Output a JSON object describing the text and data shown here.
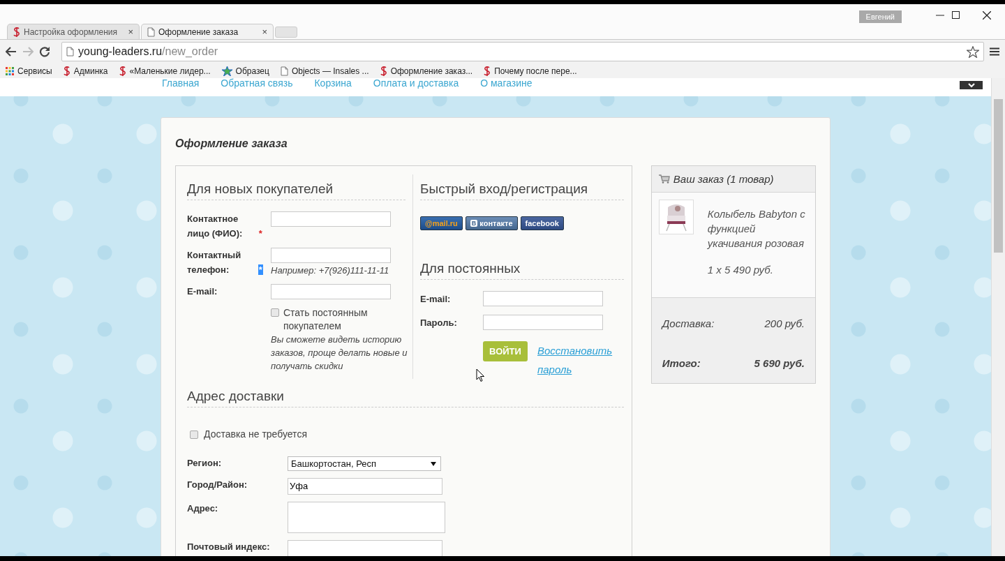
{
  "window": {
    "user_badge": "Евгений"
  },
  "tabs": [
    {
      "label": "Настройка оформления",
      "kind": "s",
      "close": "×",
      "selected": false
    },
    {
      "label": "Оформление заказа",
      "kind": "page",
      "close": "×",
      "selected": true
    }
  ],
  "address": {
    "host": "young-leaders.ru",
    "path": "/new_order"
  },
  "bookmarks": [
    {
      "label": "Сервисы",
      "kind": "apps"
    },
    {
      "label": "Админка",
      "kind": "s"
    },
    {
      "label": "«Маленькие лидер...",
      "kind": "s"
    },
    {
      "label": "Образец",
      "kind": "star"
    },
    {
      "label": "Objects — Insales ...",
      "kind": "page"
    },
    {
      "label": "Оформление заказ...",
      "kind": "s"
    },
    {
      "label": "Почему после пере...",
      "kind": "s"
    }
  ],
  "site_nav": [
    "Главная",
    "Обратная связь",
    "Корзина",
    "Оплата и доставка",
    "О магазине"
  ],
  "page_title": "Оформление заказа",
  "new_customers": {
    "heading": "Для новых покупателей",
    "fields": [
      {
        "label": "Контактное лицо (ФИО):",
        "required_mark": {
          "text": "*",
          "highlighted": false
        }
      },
      {
        "label": "Контактный телефон:",
        "required_mark": {
          "text": "*",
          "highlighted": true
        },
        "hint": "Например: +7(926)111-11-11"
      },
      {
        "label": "E-mail:"
      }
    ],
    "checkbox": {
      "label": "Стать постоянным покупателем",
      "checked": false
    },
    "note": "Вы сможете видеть историю заказов, проще делать новые и получать скидки"
  },
  "quick_login": {
    "heading": "Быстрый вход/регистрация",
    "providers": [
      {
        "kind": "mailru",
        "label": "@mail.ru"
      },
      {
        "kind": "vk",
        "mark": "В",
        "label": "контакте"
      },
      {
        "kind": "facebook",
        "label": "facebook"
      }
    ]
  },
  "regulars": {
    "heading": "Для постоянных",
    "fields": [
      {
        "label": "E-mail:"
      },
      {
        "label": "Пароль:"
      }
    ],
    "login_button": "ВОЙТИ",
    "recover_link": "Восстановить пароль"
  },
  "delivery": {
    "heading": "Адрес доставки",
    "no_delivery": {
      "label": "Доставка не требуется",
      "checked": false
    },
    "fields": [
      {
        "label": "Регион:",
        "kind": "select",
        "value": "Башкортостан, Респ"
      },
      {
        "label": "Город/Район:",
        "kind": "text",
        "value": "Уфа"
      },
      {
        "label": "Адрес:",
        "kind": "textarea"
      },
      {
        "label": "Почтовый индекс:",
        "kind": "text"
      }
    ]
  },
  "order": {
    "title": "Ваш заказ (1 товар)",
    "item": {
      "name": "Колыбель Babyton с функцией укачивания розовая",
      "qty_price": "1 x 5 490 руб."
    },
    "delivery_label": "Доставка:",
    "delivery_value": "200 руб.",
    "total_label": "Итого:",
    "total_value": "5 690 руб."
  }
}
